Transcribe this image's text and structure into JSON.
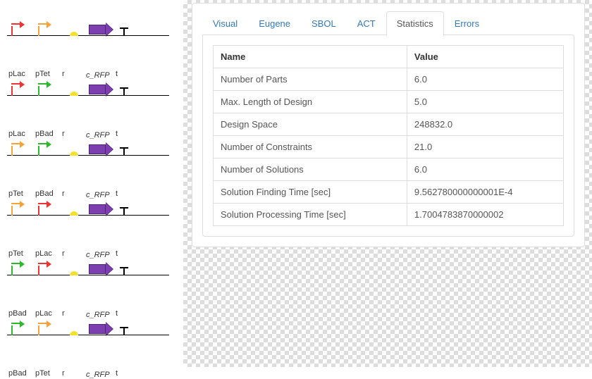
{
  "designs": [
    {
      "p1": {
        "label": "pLac",
        "color": "red"
      },
      "p2": {
        "label": "pTet",
        "color": "orange"
      },
      "rbs": "r",
      "cds": "c_RFP",
      "term": "t"
    },
    {
      "p1": {
        "label": "pLac",
        "color": "red"
      },
      "p2": {
        "label": "pBad",
        "color": "green"
      },
      "rbs": "r",
      "cds": "c_RFP",
      "term": "t"
    },
    {
      "p1": {
        "label": "pTet",
        "color": "orange"
      },
      "p2": {
        "label": "pBad",
        "color": "green"
      },
      "rbs": "r",
      "cds": "c_RFP",
      "term": "t"
    },
    {
      "p1": {
        "label": "pTet",
        "color": "orange"
      },
      "p2": {
        "label": "pLac",
        "color": "red"
      },
      "rbs": "r",
      "cds": "c_RFP",
      "term": "t"
    },
    {
      "p1": {
        "label": "pBad",
        "color": "green"
      },
      "p2": {
        "label": "pLac",
        "color": "red"
      },
      "rbs": "r",
      "cds": "c_RFP",
      "term": "t"
    },
    {
      "p1": {
        "label": "pBad",
        "color": "green"
      },
      "p2": {
        "label": "pTet",
        "color": "orange"
      },
      "rbs": "r",
      "cds": "c_RFP",
      "term": "t"
    }
  ],
  "tabs": {
    "visual": "Visual",
    "eugene": "Eugene",
    "sbol": "SBOL",
    "act": "ACT",
    "statistics": "Statistics",
    "errors": "Errors"
  },
  "table": {
    "headers": {
      "name": "Name",
      "value": "Value"
    },
    "rows": [
      {
        "name": "Number of Parts",
        "value": "6.0"
      },
      {
        "name": "Max. Length of Design",
        "value": "5.0"
      },
      {
        "name": "Design Space",
        "value": "248832.0"
      },
      {
        "name": "Number of Constraints",
        "value": "21.0"
      },
      {
        "name": "Number of Solutions",
        "value": "6.0"
      },
      {
        "name": "Solution Finding Time [sec]",
        "value": "9.562780000000001E-4"
      },
      {
        "name": "Solution Processing Time [sec]",
        "value": "1.7004783870000002"
      }
    ]
  }
}
